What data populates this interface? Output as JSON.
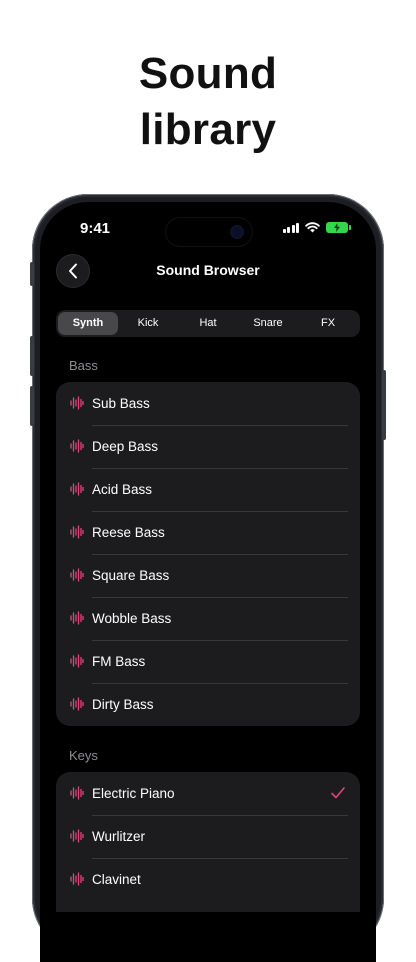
{
  "headline": {
    "line1": "Sound",
    "line2": "library"
  },
  "status": {
    "time": "9:41"
  },
  "nav": {
    "title": "Sound Browser"
  },
  "tabs": [
    {
      "label": "Synth",
      "active": true
    },
    {
      "label": "Kick",
      "active": false
    },
    {
      "label": "Hat",
      "active": false
    },
    {
      "label": "Snare",
      "active": false
    },
    {
      "label": "FX",
      "active": false
    }
  ],
  "sections": [
    {
      "title": "Bass",
      "items": [
        {
          "label": "Sub Bass",
          "selected": false
        },
        {
          "label": "Deep Bass",
          "selected": false
        },
        {
          "label": "Acid Bass",
          "selected": false
        },
        {
          "label": "Reese Bass",
          "selected": false
        },
        {
          "label": "Square Bass",
          "selected": false
        },
        {
          "label": "Wobble Bass",
          "selected": false
        },
        {
          "label": "FM Bass",
          "selected": false
        },
        {
          "label": "Dirty Bass",
          "selected": false
        }
      ]
    },
    {
      "title": "Keys",
      "items": [
        {
          "label": "Electric Piano",
          "selected": true
        },
        {
          "label": "Wurlitzer",
          "selected": false
        },
        {
          "label": "Clavinet",
          "selected": false
        }
      ]
    }
  ],
  "colors": {
    "accent": "#e0457a",
    "battery": "#32d74b",
    "background": "#000000",
    "cell": "#1c1c1e"
  },
  "icons": {
    "row": "waveform-icon",
    "back": "chevron-left-icon",
    "selected": "checkmark-icon"
  }
}
